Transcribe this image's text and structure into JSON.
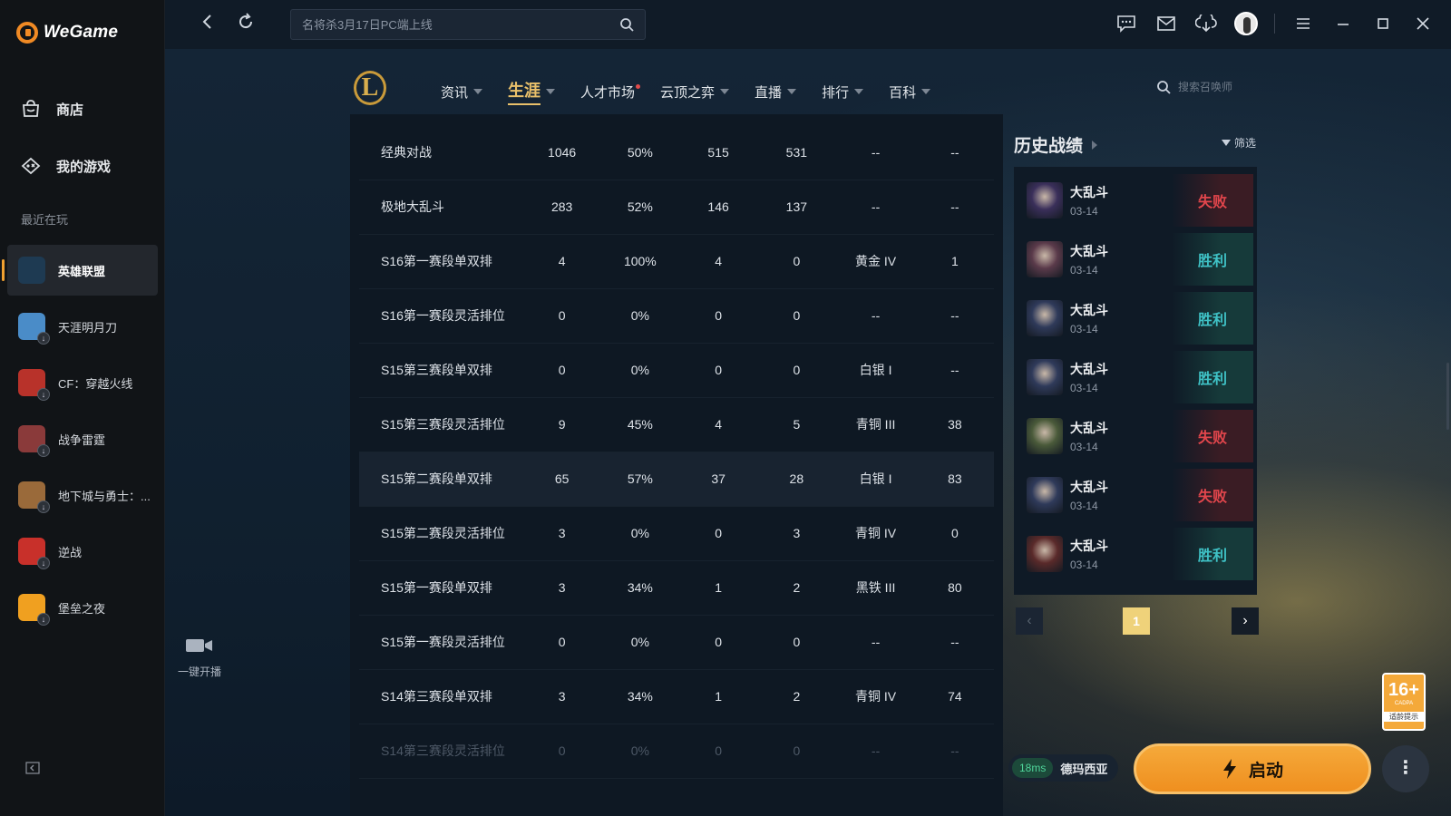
{
  "app": {
    "brand": "WeGame"
  },
  "sidebar": {
    "nav": [
      {
        "label": "商店",
        "icon": "store-icon"
      },
      {
        "label": "我的游戏",
        "icon": "games-icon"
      }
    ],
    "recent_label": "最近在玩",
    "games": [
      {
        "name": "英雄联盟",
        "active": true,
        "download": false,
        "color": "#1e3a52"
      },
      {
        "name": "天涯明月刀",
        "active": false,
        "download": true,
        "color": "#4a8cc8"
      },
      {
        "name": "CF：穿越火线",
        "active": false,
        "download": true,
        "color": "#b8322a"
      },
      {
        "name": "战争雷霆",
        "active": false,
        "download": true,
        "color": "#8a3a3a"
      },
      {
        "name": "地下城与勇士：...",
        "active": false,
        "download": true,
        "color": "#9a6a3a"
      },
      {
        "name": "逆战",
        "active": false,
        "download": true,
        "color": "#c8302a"
      },
      {
        "name": "堡垒之夜",
        "active": false,
        "download": true,
        "color": "#f0a020"
      }
    ]
  },
  "topbar": {
    "search_placeholder": "名将杀3月17日PC端上线"
  },
  "lol": {
    "tabs": [
      {
        "label": "资讯",
        "caret": true,
        "active": false,
        "dot": false
      },
      {
        "label": "生涯",
        "caret": true,
        "active": true,
        "dot": false
      },
      {
        "label": "人才市场",
        "caret": false,
        "active": false,
        "dot": true
      },
      {
        "label": "云顶之弈",
        "caret": true,
        "active": false,
        "dot": false
      },
      {
        "label": "直播",
        "caret": true,
        "active": false,
        "dot": false
      },
      {
        "label": "排行",
        "caret": true,
        "active": false,
        "dot": false
      },
      {
        "label": "百科",
        "caret": true,
        "active": false,
        "dot": false
      }
    ],
    "summoner_search_placeholder": "搜索召唤师"
  },
  "stats": {
    "rows": [
      {
        "mode": "经典对战",
        "games": "1046",
        "winrate": "50%",
        "wins": "515",
        "losses": "531",
        "rank": "--",
        "points": "--"
      },
      {
        "mode": "极地大乱斗",
        "games": "283",
        "winrate": "52%",
        "wins": "146",
        "losses": "137",
        "rank": "--",
        "points": "--"
      },
      {
        "mode": "S16第一赛段单双排",
        "games": "4",
        "winrate": "100%",
        "wins": "4",
        "losses": "0",
        "rank": "黄金 IV",
        "points": "1"
      },
      {
        "mode": "S16第一赛段灵活排位",
        "games": "0",
        "winrate": "0%",
        "wins": "0",
        "losses": "0",
        "rank": "--",
        "points": "--"
      },
      {
        "mode": "S15第三赛段单双排",
        "games": "0",
        "winrate": "0%",
        "wins": "0",
        "losses": "0",
        "rank": "白银 I",
        "points": "--"
      },
      {
        "mode": "S15第三赛段灵活排位",
        "games": "9",
        "winrate": "45%",
        "wins": "4",
        "losses": "5",
        "rank": "青铜 III",
        "points": "38"
      },
      {
        "mode": "S15第二赛段单双排",
        "games": "65",
        "winrate": "57%",
        "wins": "37",
        "losses": "28",
        "rank": "白银 I",
        "points": "83",
        "highlight": true
      },
      {
        "mode": "S15第二赛段灵活排位",
        "games": "3",
        "winrate": "0%",
        "wins": "0",
        "losses": "3",
        "rank": "青铜 IV",
        "points": "0"
      },
      {
        "mode": "S15第一赛段单双排",
        "games": "3",
        "winrate": "34%",
        "wins": "1",
        "losses": "2",
        "rank": "黑铁 III",
        "points": "80"
      },
      {
        "mode": "S15第一赛段灵活排位",
        "games": "0",
        "winrate": "0%",
        "wins": "0",
        "losses": "0",
        "rank": "--",
        "points": "--"
      },
      {
        "mode": "S14第三赛段单双排",
        "games": "3",
        "winrate": "34%",
        "wins": "1",
        "losses": "2",
        "rank": "青铜 IV",
        "points": "74"
      },
      {
        "mode": "S14第三赛段灵活排位",
        "games": "0",
        "winrate": "0%",
        "wins": "0",
        "losses": "0",
        "rank": "--",
        "points": "--",
        "faded": true
      }
    ]
  },
  "stream": {
    "label": "一键开播"
  },
  "history": {
    "title": "历史战绩",
    "filter_label": "筛选",
    "matches": [
      {
        "mode": "大乱斗",
        "date": "03-14",
        "result": "失败",
        "win": false,
        "champ_color": "#3a2f5a"
      },
      {
        "mode": "大乱斗",
        "date": "03-14",
        "result": "胜利",
        "win": true,
        "champ_color": "#5a3a4a"
      },
      {
        "mode": "大乱斗",
        "date": "03-14",
        "result": "胜利",
        "win": true,
        "champ_color": "#2f3a5a"
      },
      {
        "mode": "大乱斗",
        "date": "03-14",
        "result": "胜利",
        "win": true,
        "champ_color": "#2f3a5a"
      },
      {
        "mode": "大乱斗",
        "date": "03-14",
        "result": "失败",
        "win": false,
        "champ_color": "#4a5a3a"
      },
      {
        "mode": "大乱斗",
        "date": "03-14",
        "result": "失败",
        "win": false,
        "champ_color": "#2f3a5a"
      },
      {
        "mode": "大乱斗",
        "date": "03-14",
        "result": "胜利",
        "win": true,
        "champ_color": "#5a2a2a"
      }
    ],
    "page": "1"
  },
  "age_rating": {
    "label": "16+",
    "sub": "CADPA",
    "tip": "适龄提示"
  },
  "server": {
    "ping": "18ms",
    "name": "德玛西亚"
  },
  "launch": {
    "label": "启动"
  },
  "colors": {
    "accent": "#f0a030",
    "win": "#3fc2c6",
    "lose": "#e2464c",
    "gold": "#e9c06a"
  }
}
